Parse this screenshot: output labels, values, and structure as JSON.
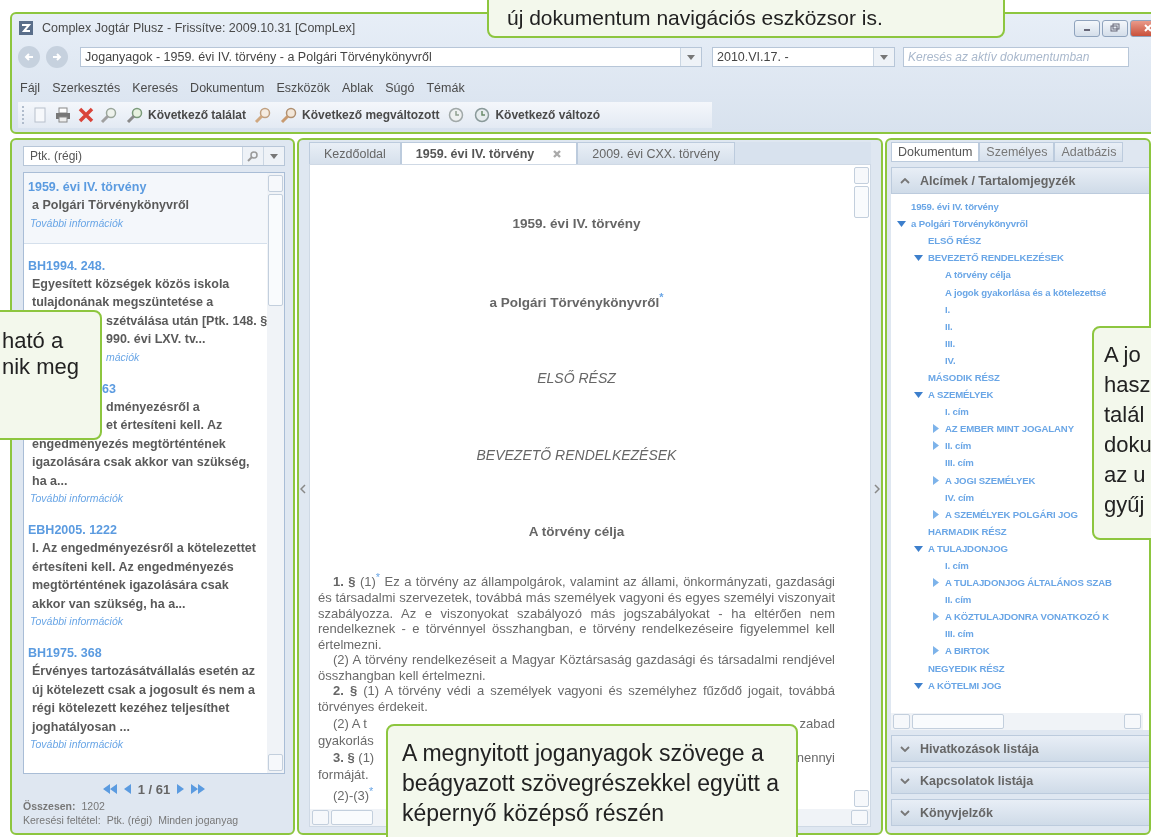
{
  "window": {
    "title": "Complex Jogtár Plusz - Frissítve: 2009.10.31 [CompLex]"
  },
  "address_bar": {
    "back": {
      "disabled": true
    },
    "forward": {
      "disabled": true
    },
    "path": "Joganyagok - 1959. évi IV. törvény - a Polgári Törvénykönyvről",
    "date": "2010.VI.17. -",
    "search": {
      "placeholder": "Keresés az aktív dokumentumban"
    }
  },
  "menu": [
    "Fájl",
    "Szerkesztés",
    "Keresés",
    "Dokumentum",
    "Eszközök",
    "Ablak",
    "Súgó",
    "Témák"
  ],
  "toolbar": [
    {
      "kind": "page"
    },
    {
      "kind": "print"
    },
    {
      "kind": "delete"
    },
    {
      "kind": "find"
    },
    {
      "kind": "find",
      "label": "Következő találat"
    },
    {
      "kind": "changed"
    },
    {
      "kind": "changed",
      "label": "Következő megváltozott"
    },
    {
      "kind": "variable"
    },
    {
      "kind": "variable",
      "label": "Következő változó"
    }
  ],
  "left_panel": {
    "search": {
      "value": "Ptk. (régi)"
    },
    "results": [
      {
        "title": "1959. évi IV. törvény",
        "title_covered": false,
        "text": "a Polgári Törvénykönyvről",
        "link": "További információk",
        "link_covered": false,
        "selected": true
      },
      {
        "title": "BH1994. 248.",
        "title_covered": false,
        "lines": [
          {
            "text": "Egyesített községek közös iskola",
            "covered": false
          },
          {
            "text": "tulajdonának megszüntetése a",
            "covered": false
          },
          {
            "text": "szétválása után [Ptk. 148. §",
            "covered": true
          },
          {
            "text": "990. évi LXV. tv...",
            "covered": true
          }
        ],
        "link": "mációk",
        "link_covered": true,
        "selected": false
      },
      {
        "title": "63",
        "title_covered": true,
        "lines": [
          {
            "text": "dményezésről a",
            "covered": true
          },
          {
            "text": "et értesíteni kell. Az",
            "covered": true
          },
          {
            "text": "engedményezés megtörténtének",
            "covered": false
          },
          {
            "text": "igazolására csak akkor van szükség,",
            "covered": false
          },
          {
            "text": "ha a...",
            "covered": false
          }
        ],
        "link": "További információk",
        "link_covered": false,
        "selected": false
      },
      {
        "title": "EBH2005. 1222",
        "title_covered": false,
        "text": "I. Az engedményezésről a kötelezettet értesíteni kell. Az engedményezés megtörténtének igazolására csak akkor van szükség, ha a...",
        "link": "További információk",
        "link_covered": false,
        "selected": false
      },
      {
        "title": "BH1975. 368",
        "title_covered": false,
        "text": "Érvényes tartozásátvállalás esetén az új kötelezett csak a jogosult és nem a régi kötelezett kezéhez teljesíthet joghatályosan ...",
        "link": "További információk",
        "link_covered": false,
        "selected": false
      }
    ],
    "pager": "1 / 61",
    "total_label": "Összesen:",
    "total": "1202",
    "filter_label": "Keresési feltétel:",
    "filter": [
      "Ptk. (régi)",
      "Minden joganyag"
    ]
  },
  "center_panel": {
    "tabs": [
      {
        "label": "Kezdőoldal",
        "selected": false,
        "closable": false
      },
      {
        "label": "1959. évi IV. törvény",
        "selected": true,
        "closable": true
      },
      {
        "label": "2009. évi CXX. törvény",
        "selected": false,
        "closable": false
      }
    ],
    "document": [
      {
        "kind": "title",
        "text": "1959. évi IV. törvény"
      },
      {
        "kind": "title",
        "text": "a Polgári Törvénykönyvről$^{*}$"
      },
      {
        "kind": "heading",
        "text": "ELSŐ RÉSZ"
      },
      {
        "kind": "heading",
        "text": "BEVEZETŐ RENDELKEZÉSEK"
      },
      {
        "kind": "title",
        "text": "A törvény célja"
      },
      {
        "kind": "para",
        "text": "**1. §** (1)$^{*}$ Ez a törvény az állampolgárok, valamint az állami, önkormányzati, gazdasági és társadalmi szervezetek, továbbá más személyek vagyoni és egyes személyi viszonyait szabályozza. Az e viszonyokat szabályozó más jogszabályokat - ha eltérően nem rendelkeznek - e törvénnyel összhangban, e törvény rendelkezéseire figyelemmel kell értelmezni."
      },
      {
        "kind": "para",
        "text": "(2) A törvény rendelkezéseit a Magyar Köztársaság gazdasági és társadalmi rendjével összhangban kell értelmezni."
      },
      {
        "kind": "para",
        "text": "**2. §** (1) A törvény védi a személyek vagyoni és személyhez fűződő jogait, továbbá törvényes érdekeit."
      },
      {
        "kind": "split",
        "left": "(2) A t",
        "right": "zabad"
      },
      {
        "kind": "line",
        "text": "gyakorlás"
      },
      {
        "kind": "split",
        "left": "**3. §** (1)",
        "right": "nennyi"
      },
      {
        "kind": "line",
        "text": "formáját."
      },
      {
        "kind": "indent",
        "text": "(2)-(3)$^{*}$"
      }
    ]
  },
  "right_panel": {
    "tabs": [
      {
        "label": "Dokumentum",
        "selected": true
      },
      {
        "label": "Személyes",
        "selected": false
      },
      {
        "label": "Adatbázis",
        "selected": false
      }
    ],
    "sections": [
      {
        "title": "Alcímek / Tartalomjegyzék",
        "expanded": true,
        "tree": [
          {
            "label": "1959. évi IV. törvény",
            "kind": "leaf"
          },
          {
            "label": "a Polgári Törvénykönyvről",
            "kind": "branch",
            "expanded": true,
            "children": [
              {
                "label": "ELSŐ RÉSZ",
                "kind": "leaf"
              },
              {
                "label": "BEVEZETŐ RENDELKEZÉSEK",
                "kind": "branch",
                "expanded": true,
                "children": [
                  {
                    "label": "A törvény célja",
                    "kind": "leaf"
                  },
                  {
                    "label": "A jogok gyakorlása és a kötelezettsé",
                    "kind": "leaf"
                  },
                  {
                    "label": "I.",
                    "kind": "leaf"
                  },
                  {
                    "label": "II.",
                    "kind": "leaf"
                  },
                  {
                    "label": "III.",
                    "kind": "leaf"
                  },
                  {
                    "label": "IV.",
                    "kind": "leaf"
                  }
                ]
              },
              {
                "label": "MÁSODIK RÉSZ",
                "kind": "leaf"
              },
              {
                "label": "A SZEMÉLYEK",
                "kind": "branch",
                "expanded": true,
                "children": [
                  {
                    "label": "I. cím",
                    "kind": "leaf"
                  },
                  {
                    "label": "AZ EMBER MINT JOGALANY",
                    "kind": "branch",
                    "expanded": false
                  },
                  {
                    "label": "II. cím",
                    "kind": "branch",
                    "expanded": false
                  },
                  {
                    "label": "III. cím",
                    "kind": "leaf"
                  },
                  {
                    "label": "A JOGI SZEMÉLYEK",
                    "kind": "branch",
                    "expanded": false
                  },
                  {
                    "label": "IV. cím",
                    "kind": "leaf"
                  },
                  {
                    "label": "A SZEMÉLYEK POLGÁRI JOG",
                    "kind": "branch",
                    "expanded": false
                  }
                ]
              },
              {
                "label": "HARMADIK RÉSZ",
                "kind": "leaf"
              },
              {
                "label": "A TULAJDONJOG",
                "kind": "branch",
                "expanded": true,
                "children": [
                  {
                    "label": "I. cím",
                    "kind": "leaf"
                  },
                  {
                    "label": "A TULAJDONJOG ÁLTALÁNOS SZAB",
                    "kind": "branch",
                    "expanded": false
                  },
                  {
                    "label": "II. cím",
                    "kind": "leaf"
                  },
                  {
                    "label": "A KÖZTULAJDONRA VONATKOZÓ K",
                    "kind": "branch",
                    "expanded": false
                  },
                  {
                    "label": "III. cím",
                    "kind": "leaf"
                  },
                  {
                    "label": "A BIRTOK",
                    "kind": "branch",
                    "expanded": false
                  }
                ]
              },
              {
                "label": "NEGYEDIK RÉSZ",
                "kind": "leaf"
              },
              {
                "label": "A KÖTELMI JOG",
                "kind": "branch",
                "expanded": true
              }
            ]
          }
        ]
      },
      {
        "title": "Hivatkozások listája",
        "expanded": false
      },
      {
        "title": "Kapcsolatok listája",
        "expanded": false
      },
      {
        "title": "Könyvjelzők",
        "expanded": false
      }
    ]
  },
  "callouts": {
    "top": "új dokumentum navigációs eszközsor is.",
    "left": [
      "ható a",
      "nik meg"
    ],
    "right": [
      "A jo",
      "hasz",
      "talál",
      "doku",
      "az u",
      "gyűj"
    ],
    "bottom": "A megnyitott joganyagok szövege a beágyazott szövegrészekkel együtt a képernyő középső részén"
  }
}
